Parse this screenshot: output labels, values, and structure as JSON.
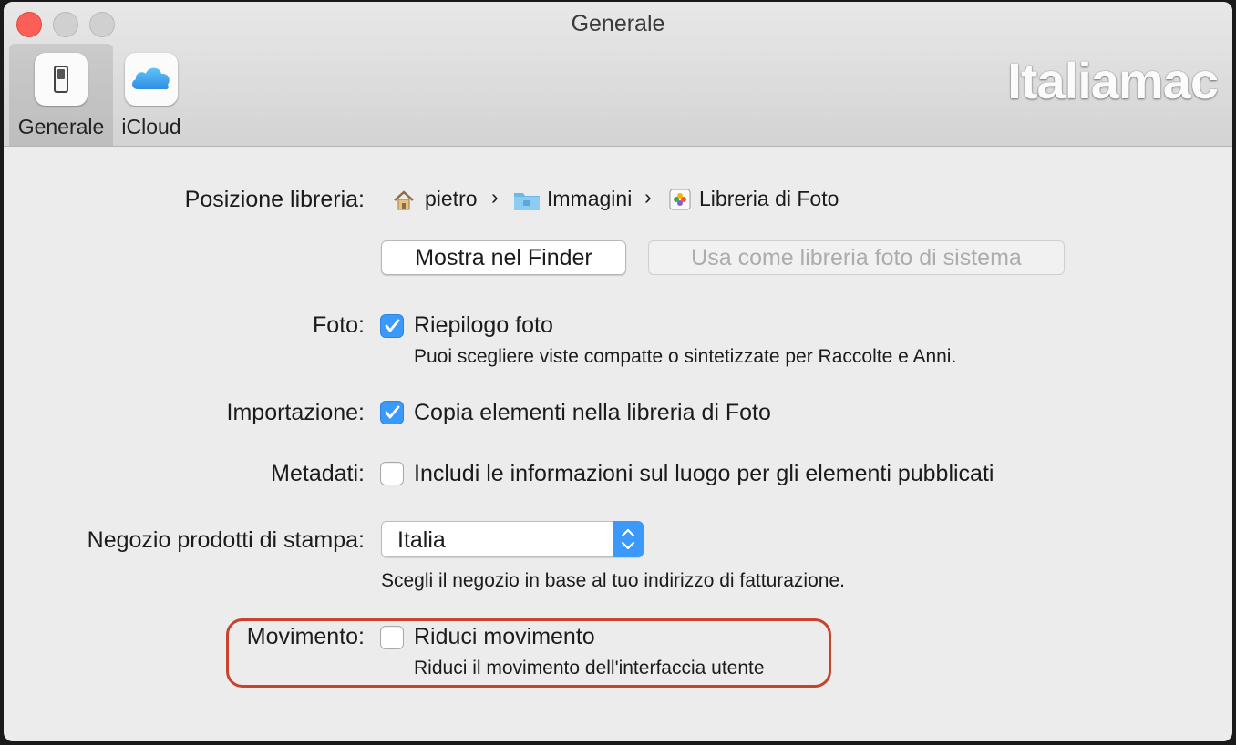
{
  "window": {
    "title": "Generale"
  },
  "toolbar": {
    "items": [
      {
        "label": "Generale",
        "icon": "switch-icon",
        "selected": true
      },
      {
        "label": "iCloud",
        "icon": "icloud-icon",
        "selected": false
      }
    ],
    "watermark": "Italiamac"
  },
  "library": {
    "label": "Posizione libreria:",
    "path": [
      {
        "name": "pietro",
        "icon": "home-icon"
      },
      {
        "name": "Immagini",
        "icon": "folder-icon"
      },
      {
        "name": "Libreria di Foto",
        "icon": "photos-library-icon"
      }
    ],
    "separator": "›",
    "show_in_finder": "Mostra nel Finder",
    "use_as_system": "Usa come libreria foto di sistema"
  },
  "photos": {
    "label": "Foto:",
    "checkbox_label": "Riepilogo foto",
    "checked": true,
    "description": "Puoi scegliere viste compatte o sintetizzate per Raccolte e Anni."
  },
  "import": {
    "label": "Importazione:",
    "checkbox_label": "Copia elementi nella libreria di Foto",
    "checked": true
  },
  "metadata": {
    "label": "Metadati:",
    "checkbox_label": "Includi le informazioni sul luogo per gli elementi pubblicati",
    "checked": false
  },
  "print_store": {
    "label": "Negozio prodotti di stampa:",
    "selected": "Italia",
    "description": "Scegli il negozio in base al tuo indirizzo di fatturazione."
  },
  "motion": {
    "label": "Movimento:",
    "checkbox_label": "Riduci movimento",
    "checked": false,
    "description": "Riduci il movimento dell'interfaccia utente"
  },
  "colors": {
    "accent": "#3b99fc",
    "highlight": "#c8432c",
    "close": "#fc5f57"
  }
}
